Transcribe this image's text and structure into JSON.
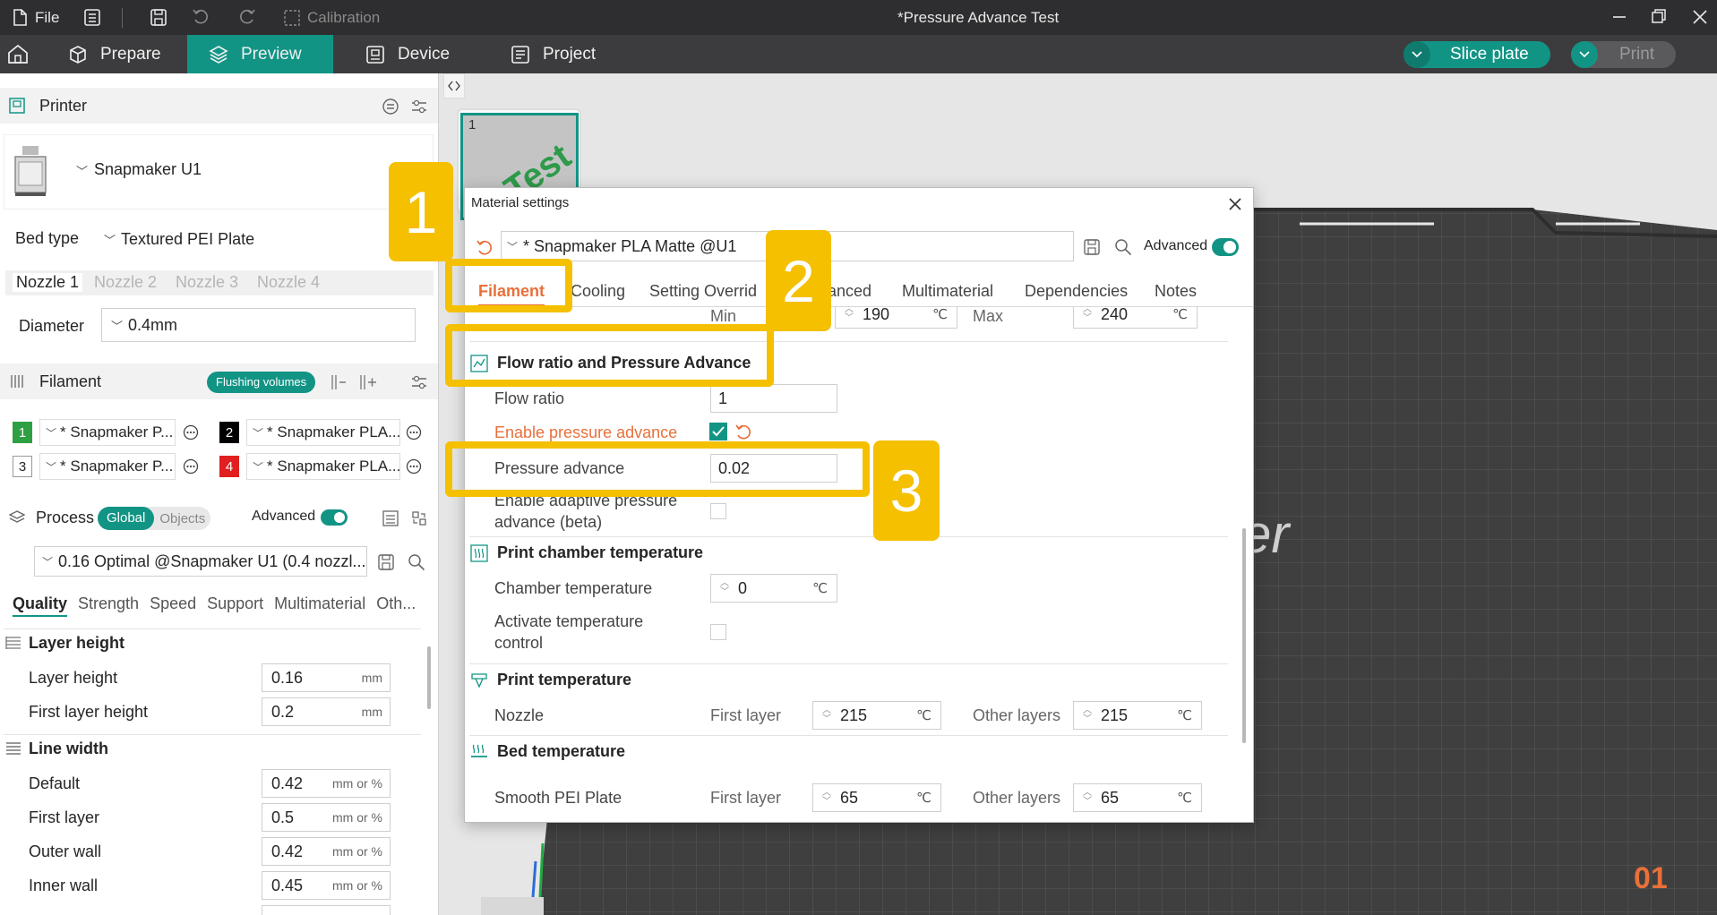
{
  "titlebar": {
    "file_label": "File",
    "calibration_label": "Calibration",
    "title": "*Pressure Advance Test"
  },
  "menubar": {
    "tabs": [
      {
        "label": "Prepare"
      },
      {
        "label": "Preview",
        "active": true
      },
      {
        "label": "Device"
      },
      {
        "label": "Project"
      }
    ],
    "slice_plate_label": "Slice plate",
    "print_label": "Print"
  },
  "printer": {
    "section_label": "Printer",
    "name": "Snapmaker U1",
    "bed_type_label": "Bed type",
    "bed_type_value": "Textured PEI Plate",
    "nozzle_tabs": [
      "Nozzle 1",
      "Nozzle 2",
      "Nozzle 3",
      "Nozzle 4"
    ],
    "diameter_label": "Diameter",
    "diameter_value": "0.4mm"
  },
  "filament": {
    "section_label": "Filament",
    "flushing_label": "Flushing volumes",
    "slots": [
      {
        "num": "1",
        "name": "* Snapmaker P...",
        "color": "#2ea043"
      },
      {
        "num": "2",
        "name": "* Snapmaker PLA...",
        "color": "#000000"
      },
      {
        "num": "3",
        "name": "* Snapmaker P...",
        "color": "#ffffff"
      },
      {
        "num": "4",
        "name": "* Snapmaker PLA...",
        "color": "#e02020"
      }
    ]
  },
  "process": {
    "section_label": "Process",
    "global_label": "Global",
    "objects_label": "Objects",
    "advanced_label": "Advanced",
    "preset": "0.16 Optimal @Snapmaker U1 (0.4 nozzl...",
    "tabs": [
      "Quality",
      "Strength",
      "Speed",
      "Support",
      "Multimaterial",
      "Oth..."
    ],
    "layer_height_group": "Layer height",
    "layer_height_label": "Layer height",
    "layer_height_value": "0.16",
    "first_layer_height_label": "First layer height",
    "first_layer_height_value": "0.2",
    "unit_mm": "mm",
    "line_width_group": "Line width",
    "unit_mm_pct": "mm or %",
    "line_widths": [
      {
        "label": "Default",
        "value": "0.42"
      },
      {
        "label": "First layer",
        "value": "0.5"
      },
      {
        "label": "Outer wall",
        "value": "0.42"
      },
      {
        "label": "Inner wall",
        "value": "0.45"
      }
    ]
  },
  "dialog": {
    "title": "Material settings",
    "preset": "* Snapmaker PLA Matte @U1",
    "advanced_label": "Advanced",
    "tabs": [
      "Filament",
      "Cooling",
      "Setting Override",
      "Advanced",
      "Multimaterial",
      "Dependencies",
      "Notes"
    ],
    "tab_visible_text": [
      "Filament",
      "Cooling",
      "Setting Overrid",
      "anced",
      "Multimaterial",
      "Dependencies",
      "Notes"
    ],
    "partial_row": {
      "min_label": "Min",
      "min_value": "190",
      "max_label": "Max",
      "max_value": "240"
    },
    "flow_group": "Flow ratio and Pressure Advance",
    "flow_ratio_label": "Flow ratio",
    "flow_ratio_value": "1",
    "enable_pa_label": "Enable pressure advance",
    "pressure_advance_label": "Pressure advance",
    "pressure_advance_value": "0.02",
    "adaptive_pa_label_1": "Enable adaptive pressure",
    "adaptive_pa_label_2": "advance (beta)",
    "chamber_group": "Print chamber temperature",
    "chamber_temp_label": "Chamber temperature",
    "chamber_temp_value": "0",
    "activate_temp_label_1": "Activate temperature",
    "activate_temp_label_2": "control",
    "print_temp_group": "Print temperature",
    "nozzle_label": "Nozzle",
    "first_layer_label": "First layer",
    "other_layers_label": "Other layers",
    "nozzle_first": "215",
    "nozzle_other": "215",
    "bed_group": "Bed temperature",
    "smooth_pei_label": "Smooth PEI Plate",
    "bed_first": "65",
    "bed_other": "65",
    "unit_c": "℃"
  },
  "plate": {
    "thumb_num": "1",
    "thumb_text": "Test",
    "plate_number": "01",
    "logo_fragment": "er"
  },
  "callouts": [
    "1",
    "2",
    "3"
  ],
  "colors": {
    "accent": "#129485",
    "callout": "#f5c000",
    "enable_pa_text": "#e8703a"
  }
}
